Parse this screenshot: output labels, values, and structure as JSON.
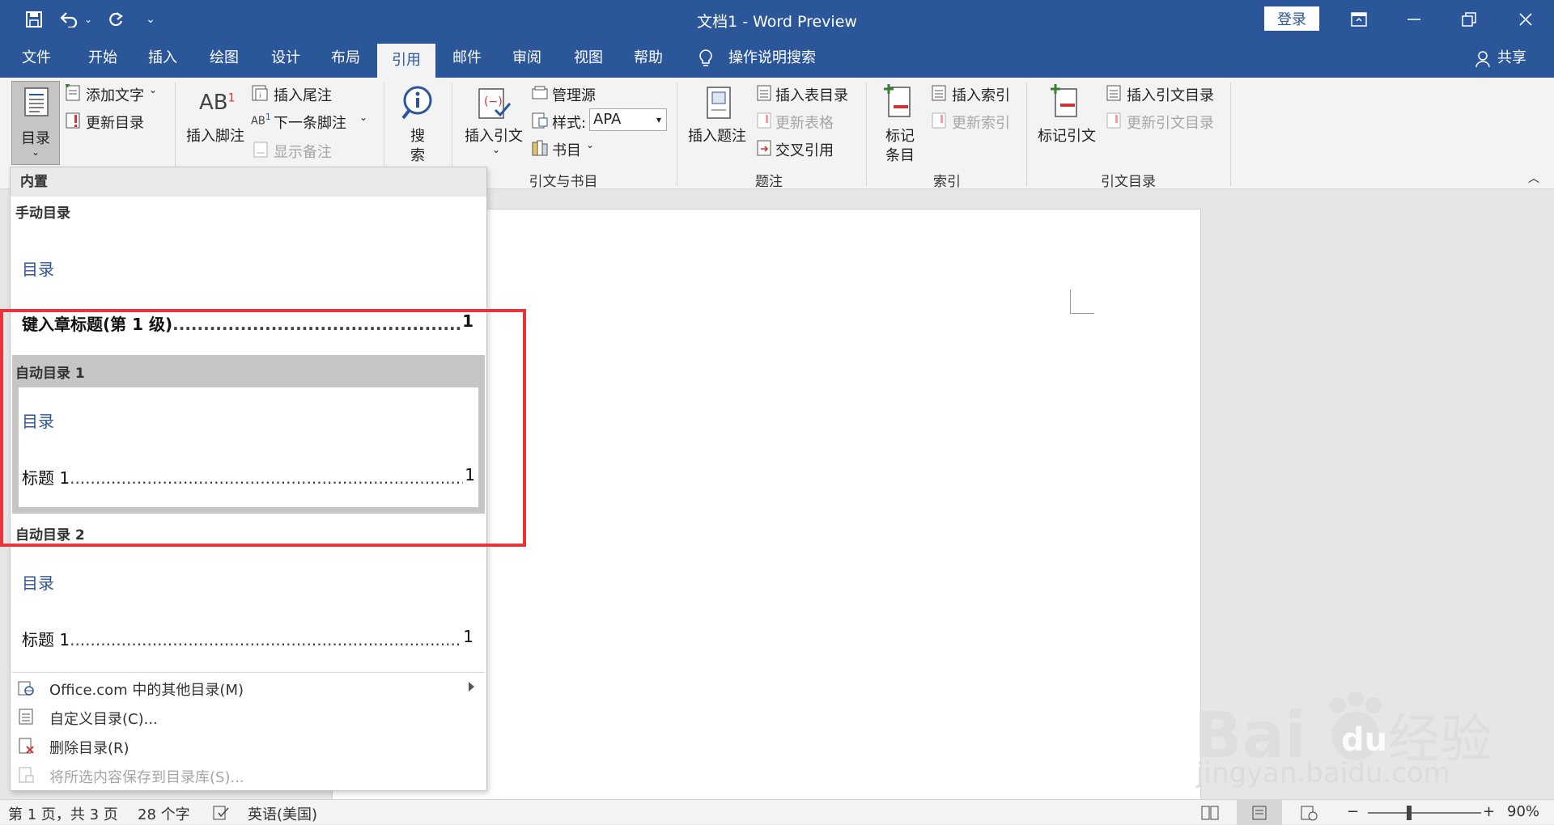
{
  "window": {
    "title": "文档1 - Word Preview",
    "login_label": "登录"
  },
  "tabs": [
    {
      "label": "文件"
    },
    {
      "label": "开始"
    },
    {
      "label": "插入"
    },
    {
      "label": "绘图"
    },
    {
      "label": "设计"
    },
    {
      "label": "布局"
    },
    {
      "label": "引用"
    },
    {
      "label": "邮件"
    },
    {
      "label": "审阅"
    },
    {
      "label": "视图"
    },
    {
      "label": "帮助"
    }
  ],
  "tell_me": "操作说明搜索",
  "share": "共享",
  "ribbon": {
    "toc": {
      "big": "目录",
      "add_text": "添加文字",
      "update": "更新目录"
    },
    "footnotes": {
      "insert_footnote": "插入脚注",
      "insert_endnote": "插入尾注",
      "next_footnote": "下一条脚注",
      "show_notes": "显示备注"
    },
    "research": {
      "search": "搜",
      "search2": "索"
    },
    "citations": {
      "insert_citation": "插入引文",
      "manage_sources": "管理源",
      "style_label": "样式:",
      "style_value": "APA",
      "bibliography": "书目",
      "group": "引文与书目"
    },
    "captions": {
      "insert_caption": "插入题注",
      "insert_tof": "插入表目录",
      "update_table": "更新表格",
      "cross_ref": "交叉引用",
      "group": "题注"
    },
    "index": {
      "mark_entry_1": "标记",
      "mark_entry_2": "条目",
      "insert_index": "插入索引",
      "update_index": "更新索引",
      "group": "索引"
    },
    "toa": {
      "mark_citation": "标记引文",
      "insert_toa": "插入引文目录",
      "update_toa": "更新引文目录",
      "group": "引文目录"
    }
  },
  "dropdown": {
    "header": "内置",
    "manual": {
      "title": "手动目录",
      "heading": "目录",
      "entry": "键入章标题(第 1 级)",
      "page": "1"
    },
    "auto1": {
      "title": "自动目录 1",
      "heading": "目录",
      "entry": "标题 1",
      "page": "1"
    },
    "auto2": {
      "title": "自动目录 2",
      "heading": "目录",
      "entry": "标题 1",
      "page": "1"
    },
    "menu": {
      "office": "Office.com 中的其他目录(M)",
      "custom": "自定义目录(C)...",
      "remove": "删除目录(R)",
      "save": "将所选内容保存到目录库(S)..."
    }
  },
  "status": {
    "page": "第 1 页，共 3 页",
    "words": "28 个字",
    "language": "英语(美国)",
    "zoom": "90%"
  },
  "watermark": {
    "url": "jingyan.baidu.com"
  }
}
